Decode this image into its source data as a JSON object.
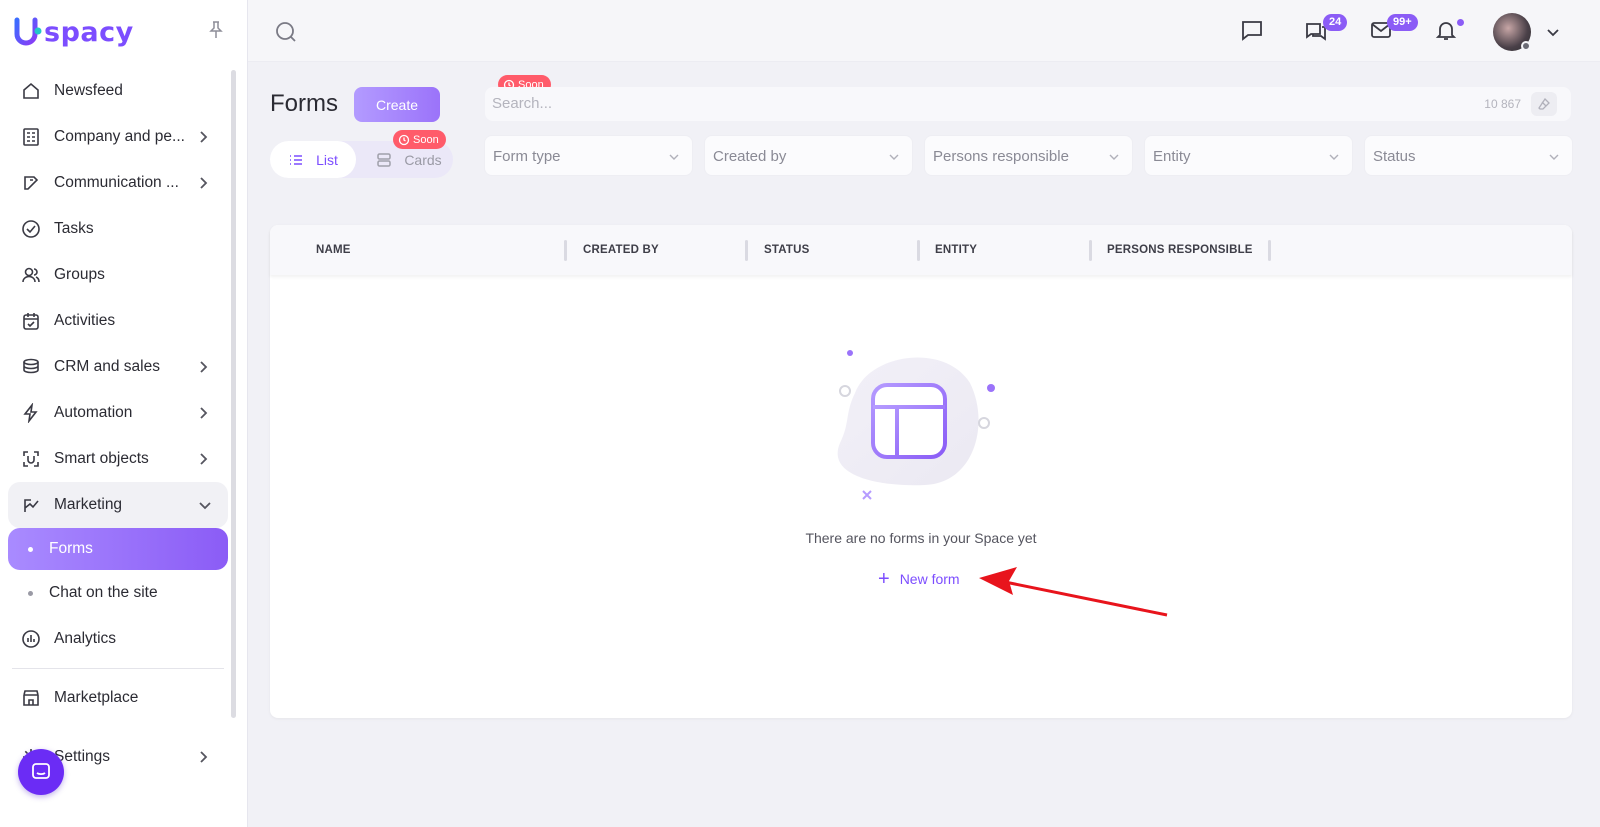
{
  "app": {
    "logo_text": "spacy"
  },
  "sidebar": {
    "items": [
      {
        "label": "Newsfeed",
        "icon": "home-icon",
        "has_children": false
      },
      {
        "label": "Company and pe...",
        "icon": "company-icon",
        "has_children": true
      },
      {
        "label": "Communication ...",
        "icon": "communication-icon",
        "has_children": true
      },
      {
        "label": "Tasks",
        "icon": "tasks-icon",
        "has_children": false
      },
      {
        "label": "Groups",
        "icon": "groups-icon",
        "has_children": false
      },
      {
        "label": "Activities",
        "icon": "calendar-icon",
        "has_children": false
      },
      {
        "label": "CRM and sales",
        "icon": "crm-icon",
        "has_children": true
      },
      {
        "label": "Automation",
        "icon": "lightning-icon",
        "has_children": true
      },
      {
        "label": "Smart objects",
        "icon": "smart-objects-icon",
        "has_children": true
      },
      {
        "label": "Marketing",
        "icon": "marketing-icon",
        "has_children": true,
        "expanded": true
      },
      {
        "label": "Forms",
        "sub": true,
        "active": true
      },
      {
        "label": "Chat on the site",
        "sub": true
      },
      {
        "label": "Analytics",
        "icon": "analytics-icon",
        "has_children": false
      },
      {
        "label": "Marketplace",
        "icon": "marketplace-icon",
        "has_children": false
      },
      {
        "label": "Settings",
        "icon": "gear-icon",
        "has_children": true
      }
    ]
  },
  "topbar": {
    "chats_badge": "24",
    "mail_badge": "99+"
  },
  "header": {
    "title": "Forms",
    "create_label": "Create",
    "view_list_label": "List",
    "view_cards_label": "Cards",
    "soon_label": "Soon",
    "search_placeholder": "Search...",
    "search_count": "10 867"
  },
  "filters": [
    "Form type",
    "Created by",
    "Persons responsible",
    "Entity",
    "Status"
  ],
  "table": {
    "columns": [
      "NAME",
      "CREATED BY",
      "STATUS",
      "ENTITY",
      "PERSONS RESPONSIBLE"
    ]
  },
  "empty_state": {
    "message": "There are no forms in your Space yet",
    "action_label": "New form"
  },
  "colors": {
    "accent": "#7c4dff",
    "soon_badge": "#ff5b6a",
    "annotation_arrow": "#e8141c"
  }
}
